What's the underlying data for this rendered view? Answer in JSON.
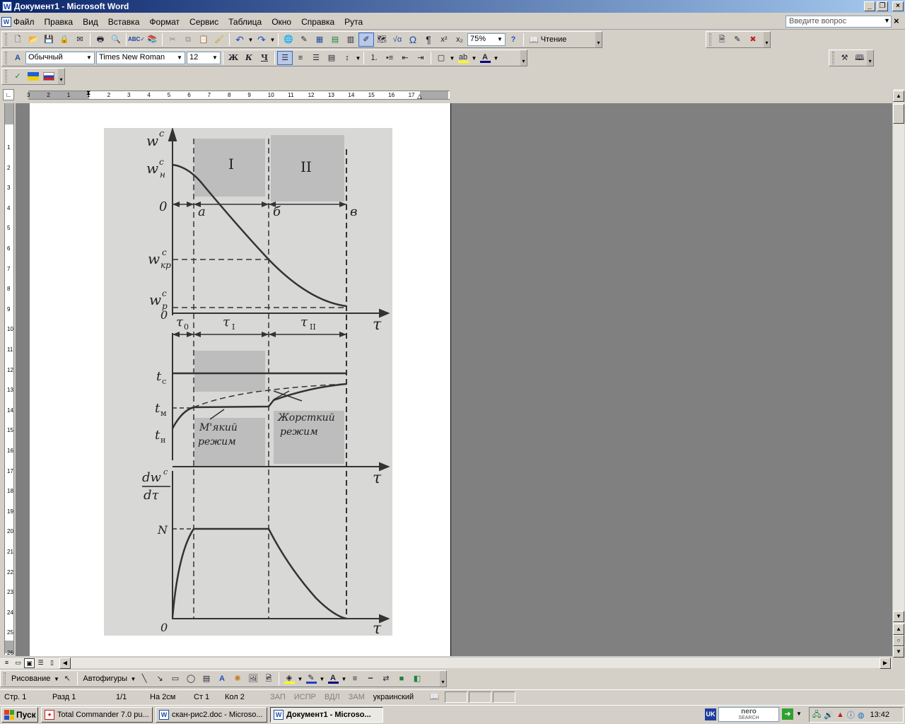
{
  "window": {
    "title": "Документ1 - Microsoft Word",
    "app_icon": "W"
  },
  "menu": {
    "doc_icon": "W",
    "items": [
      "Файл",
      "Правка",
      "Вид",
      "Вставка",
      "Формат",
      "Сервис",
      "Таблица",
      "Окно",
      "Справка",
      "Рута"
    ],
    "ask_placeholder": "Введите вопрос",
    "close_doc": "×"
  },
  "toolbar_standard": {
    "zoom": "75%",
    "read_label": "Чтение"
  },
  "toolbar_format": {
    "style": "Обычный",
    "font": "Times New Roman",
    "size": "12",
    "bold": "Ж",
    "italic": "К",
    "underline": "Ч"
  },
  "hruler_labels": [
    "3",
    "2",
    "1",
    "1",
    "2",
    "3",
    "4",
    "5",
    "6",
    "7",
    "8",
    "9",
    "10",
    "11",
    "12",
    "13",
    "14",
    "15",
    "16",
    "17"
  ],
  "vruler_labels": [
    "1",
    "2",
    "3",
    "4",
    "5",
    "6",
    "7",
    "8",
    "9",
    "10",
    "11",
    "12",
    "13",
    "14",
    "15",
    "16",
    "17",
    "18",
    "19",
    "20",
    "21",
    "22",
    "23",
    "24",
    "25",
    "26"
  ],
  "figure": {
    "zone_1": "I",
    "zone_2": "II",
    "wc": "w",
    "wc_sup": "c",
    "wn_sub": "н",
    "wkr_sub": "кр",
    "wp_sub": "р",
    "zero": "0",
    "pt_a": "а",
    "pt_b": "б",
    "pt_c": "в",
    "tau": "τ",
    "tau_0": "0",
    "tau_1": "I",
    "tau_2": "II",
    "t": "t",
    "tc_sub": "c",
    "tm_sub": "м",
    "tn_sub": "н",
    "soft_1": "М'який",
    "soft_2": "режим",
    "hard_1": "Жорсткий",
    "hard_2": "режим",
    "dw": "dw",
    "dtau": "dτ",
    "N": "N"
  },
  "drawing_toolbar": {
    "drawing": "Рисование",
    "autoshapes": "Автофигуры"
  },
  "status": {
    "page": "Стр.  1",
    "section": "Разд  1",
    "pages": "1/1",
    "at": "На  2см",
    "line": "Ст  1",
    "col": "Кол  2",
    "rec": "ЗАП",
    "trk": "ИСПР",
    "ext": "ВДЛ",
    "ovr": "ЗАМ",
    "lang": "украинский"
  },
  "taskbar": {
    "start": "Пуск",
    "tasks": [
      "Total Commander 7.0 pu...",
      "скан-рис2.doc - Microso...",
      "Документ1 - Microso..."
    ],
    "lang_indicator": "UK",
    "nero_line1": "nero",
    "nero_line2": "SEARCH",
    "clock": "13:42"
  },
  "colors": {
    "title_start": "#0a246a",
    "title_end": "#a6caf0",
    "workspace": "#808080",
    "chrome": "#d4d0c8"
  }
}
